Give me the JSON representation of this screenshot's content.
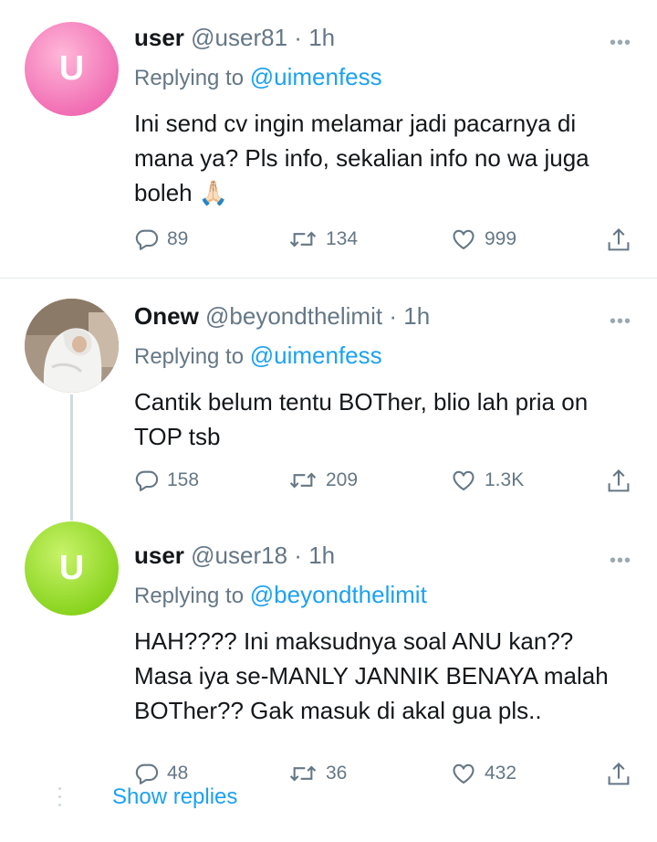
{
  "tweets": [
    {
      "avatar_letter": "U",
      "name": "user",
      "handle": "@user81",
      "time": "1h",
      "replying_label": "Replying to",
      "replying_to": "@uimenfess",
      "text": "Ini send cv ingin melamar jadi pacarnya di mana ya? Pls info, sekalian info no wa juga boleh 🙏🏻",
      "replies": "89",
      "retweets": "134",
      "likes": "999"
    },
    {
      "avatar_letter": "",
      "name": "Onew",
      "handle": "@beyondthelimit",
      "time": "1h",
      "replying_label": "Replying to",
      "replying_to": "@uimenfess",
      "text": "Cantik belum tentu BOTher, blio lah pria on TOP tsb",
      "replies": "158",
      "retweets": "209",
      "likes": "1.3K"
    },
    {
      "avatar_letter": "U",
      "name": "user",
      "handle": "@user18",
      "time": "1h",
      "replying_label": "Replying to",
      "replying_to": "@beyondthelimit",
      "text": "HAH???? Ini maksudnya soal ANU kan?? Masa iya se-MANLY JANNIK BENAYA malah BOTher?? Gak masuk di akal gua pls..",
      "replies": "48",
      "retweets": "36",
      "likes": "432"
    }
  ],
  "separator": "·",
  "show_replies": "Show replies",
  "icons": {
    "reply": "reply-icon",
    "retweet": "retweet-icon",
    "like": "heart-icon",
    "share": "share-icon",
    "more": "more-icon"
  },
  "colors": {
    "accent": "#1da1f2",
    "secondary_text": "#657786",
    "avatar_pink": "#f06ab2",
    "avatar_green": "#86d21b"
  }
}
